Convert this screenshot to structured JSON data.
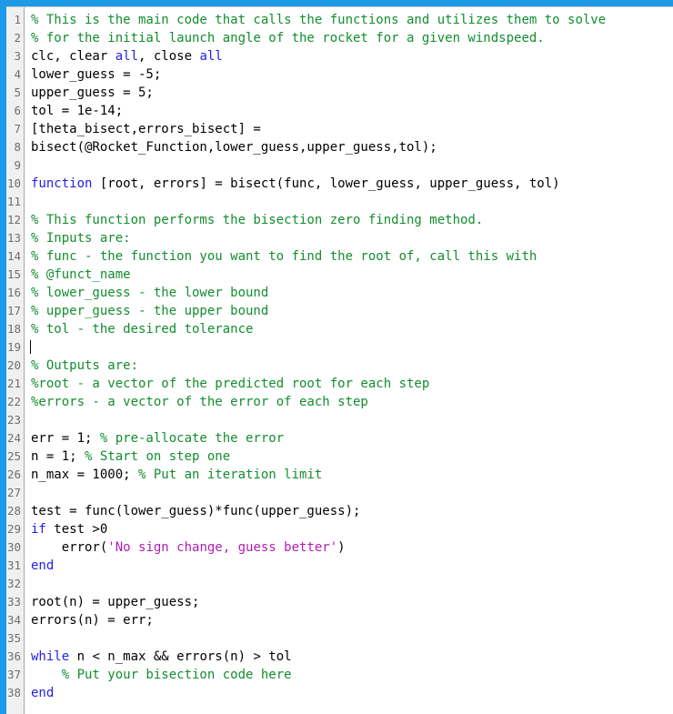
{
  "window": {
    "title": "MATLAB Editor",
    "accent_color": "#1c9ae8",
    "gutter_bg": "#f0f0f0",
    "background": "#ffffff"
  },
  "syntax_colors": {
    "comment": "#138d2e",
    "keyword": "#1f1fe6",
    "string": "#b020b0",
    "plain": "#000000",
    "linenumber": "#6e6e6e"
  },
  "editor": {
    "cursor_line": 19,
    "cursor_column": 1,
    "first_visible_line": 1,
    "last_visible_line": 38,
    "lines": [
      {
        "n": 1,
        "tokens": [
          {
            "t": "comment",
            "s": "% This is the main code that calls the functions and utilizes them to solve"
          }
        ]
      },
      {
        "n": 2,
        "tokens": [
          {
            "t": "comment",
            "s": "% for the initial launch angle of the rocket for a given windspeed."
          }
        ]
      },
      {
        "n": 3,
        "tokens": [
          {
            "t": "plain",
            "s": "clc, clear "
          },
          {
            "t": "keyword",
            "s": "all"
          },
          {
            "t": "plain",
            "s": ", close "
          },
          {
            "t": "keyword",
            "s": "all"
          }
        ]
      },
      {
        "n": 4,
        "tokens": [
          {
            "t": "plain",
            "s": "lower_guess = -5;"
          }
        ]
      },
      {
        "n": 5,
        "tokens": [
          {
            "t": "plain",
            "s": "upper_guess = 5;"
          }
        ]
      },
      {
        "n": 6,
        "tokens": [
          {
            "t": "plain",
            "s": "tol = 1e-14;"
          }
        ]
      },
      {
        "n": 7,
        "tokens": [
          {
            "t": "plain",
            "s": "[theta_bisect,errors_bisect] = "
          }
        ]
      },
      {
        "n": 8,
        "tokens": [
          {
            "t": "plain",
            "s": "bisect(@Rocket_Function,lower_guess,upper_guess,tol);"
          }
        ]
      },
      {
        "n": 9,
        "tokens": [
          {
            "t": "plain",
            "s": ""
          }
        ]
      },
      {
        "n": 10,
        "tokens": [
          {
            "t": "keyword",
            "s": "function"
          },
          {
            "t": "plain",
            "s": " [root, errors] = bisect(func, lower_guess, upper_guess, tol)"
          }
        ]
      },
      {
        "n": 11,
        "tokens": [
          {
            "t": "plain",
            "s": ""
          }
        ]
      },
      {
        "n": 12,
        "tokens": [
          {
            "t": "comment",
            "s": "% This function performs the bisection zero finding method."
          }
        ]
      },
      {
        "n": 13,
        "tokens": [
          {
            "t": "comment",
            "s": "% Inputs are:"
          }
        ]
      },
      {
        "n": 14,
        "tokens": [
          {
            "t": "comment",
            "s": "% func - the function you want to find the root of, call this with"
          }
        ]
      },
      {
        "n": 15,
        "tokens": [
          {
            "t": "comment",
            "s": "% @funct_name"
          }
        ]
      },
      {
        "n": 16,
        "tokens": [
          {
            "t": "comment",
            "s": "% lower_guess - the lower bound"
          }
        ]
      },
      {
        "n": 17,
        "tokens": [
          {
            "t": "comment",
            "s": "% upper_guess - the upper bound"
          }
        ]
      },
      {
        "n": 18,
        "tokens": [
          {
            "t": "comment",
            "s": "% tol - the desired tolerance"
          }
        ]
      },
      {
        "n": 19,
        "tokens": [
          {
            "t": "plain",
            "s": ""
          }
        ]
      },
      {
        "n": 20,
        "tokens": [
          {
            "t": "comment",
            "s": "% Outputs are:"
          }
        ]
      },
      {
        "n": 21,
        "tokens": [
          {
            "t": "comment",
            "s": "%root - a vector of the predicted root for each step"
          }
        ]
      },
      {
        "n": 22,
        "tokens": [
          {
            "t": "comment",
            "s": "%errors - a vector of the error of each step"
          }
        ]
      },
      {
        "n": 23,
        "tokens": [
          {
            "t": "plain",
            "s": ""
          }
        ]
      },
      {
        "n": 24,
        "tokens": [
          {
            "t": "plain",
            "s": "err = 1; "
          },
          {
            "t": "comment",
            "s": "% pre-allocate the error"
          }
        ]
      },
      {
        "n": 25,
        "tokens": [
          {
            "t": "plain",
            "s": "n = 1; "
          },
          {
            "t": "comment",
            "s": "% Start on step one"
          }
        ]
      },
      {
        "n": 26,
        "tokens": [
          {
            "t": "plain",
            "s": "n_max = 1000; "
          },
          {
            "t": "comment",
            "s": "% Put an iteration limit"
          }
        ]
      },
      {
        "n": 27,
        "tokens": [
          {
            "t": "plain",
            "s": ""
          }
        ]
      },
      {
        "n": 28,
        "tokens": [
          {
            "t": "plain",
            "s": "test = func(lower_guess)*func(upper_guess);"
          }
        ]
      },
      {
        "n": 29,
        "tokens": [
          {
            "t": "keyword",
            "s": "if"
          },
          {
            "t": "plain",
            "s": " test >0"
          }
        ]
      },
      {
        "n": 30,
        "tokens": [
          {
            "t": "plain",
            "s": "    error("
          },
          {
            "t": "string",
            "s": "'No sign change, guess better'"
          },
          {
            "t": "plain",
            "s": ")"
          }
        ]
      },
      {
        "n": 31,
        "tokens": [
          {
            "t": "keyword",
            "s": "end"
          }
        ]
      },
      {
        "n": 32,
        "tokens": [
          {
            "t": "plain",
            "s": ""
          }
        ]
      },
      {
        "n": 33,
        "tokens": [
          {
            "t": "plain",
            "s": "root(n) = upper_guess;"
          }
        ]
      },
      {
        "n": 34,
        "tokens": [
          {
            "t": "plain",
            "s": "errors(n) = err;"
          }
        ]
      },
      {
        "n": 35,
        "tokens": [
          {
            "t": "plain",
            "s": ""
          }
        ]
      },
      {
        "n": 36,
        "tokens": [
          {
            "t": "keyword",
            "s": "while"
          },
          {
            "t": "plain",
            "s": " n < n_max && errors(n) > tol"
          }
        ]
      },
      {
        "n": 37,
        "tokens": [
          {
            "t": "plain",
            "s": "    "
          },
          {
            "t": "comment",
            "s": "% Put your bisection code here"
          }
        ]
      },
      {
        "n": 38,
        "tokens": [
          {
            "t": "keyword",
            "s": "end"
          }
        ]
      }
    ]
  }
}
